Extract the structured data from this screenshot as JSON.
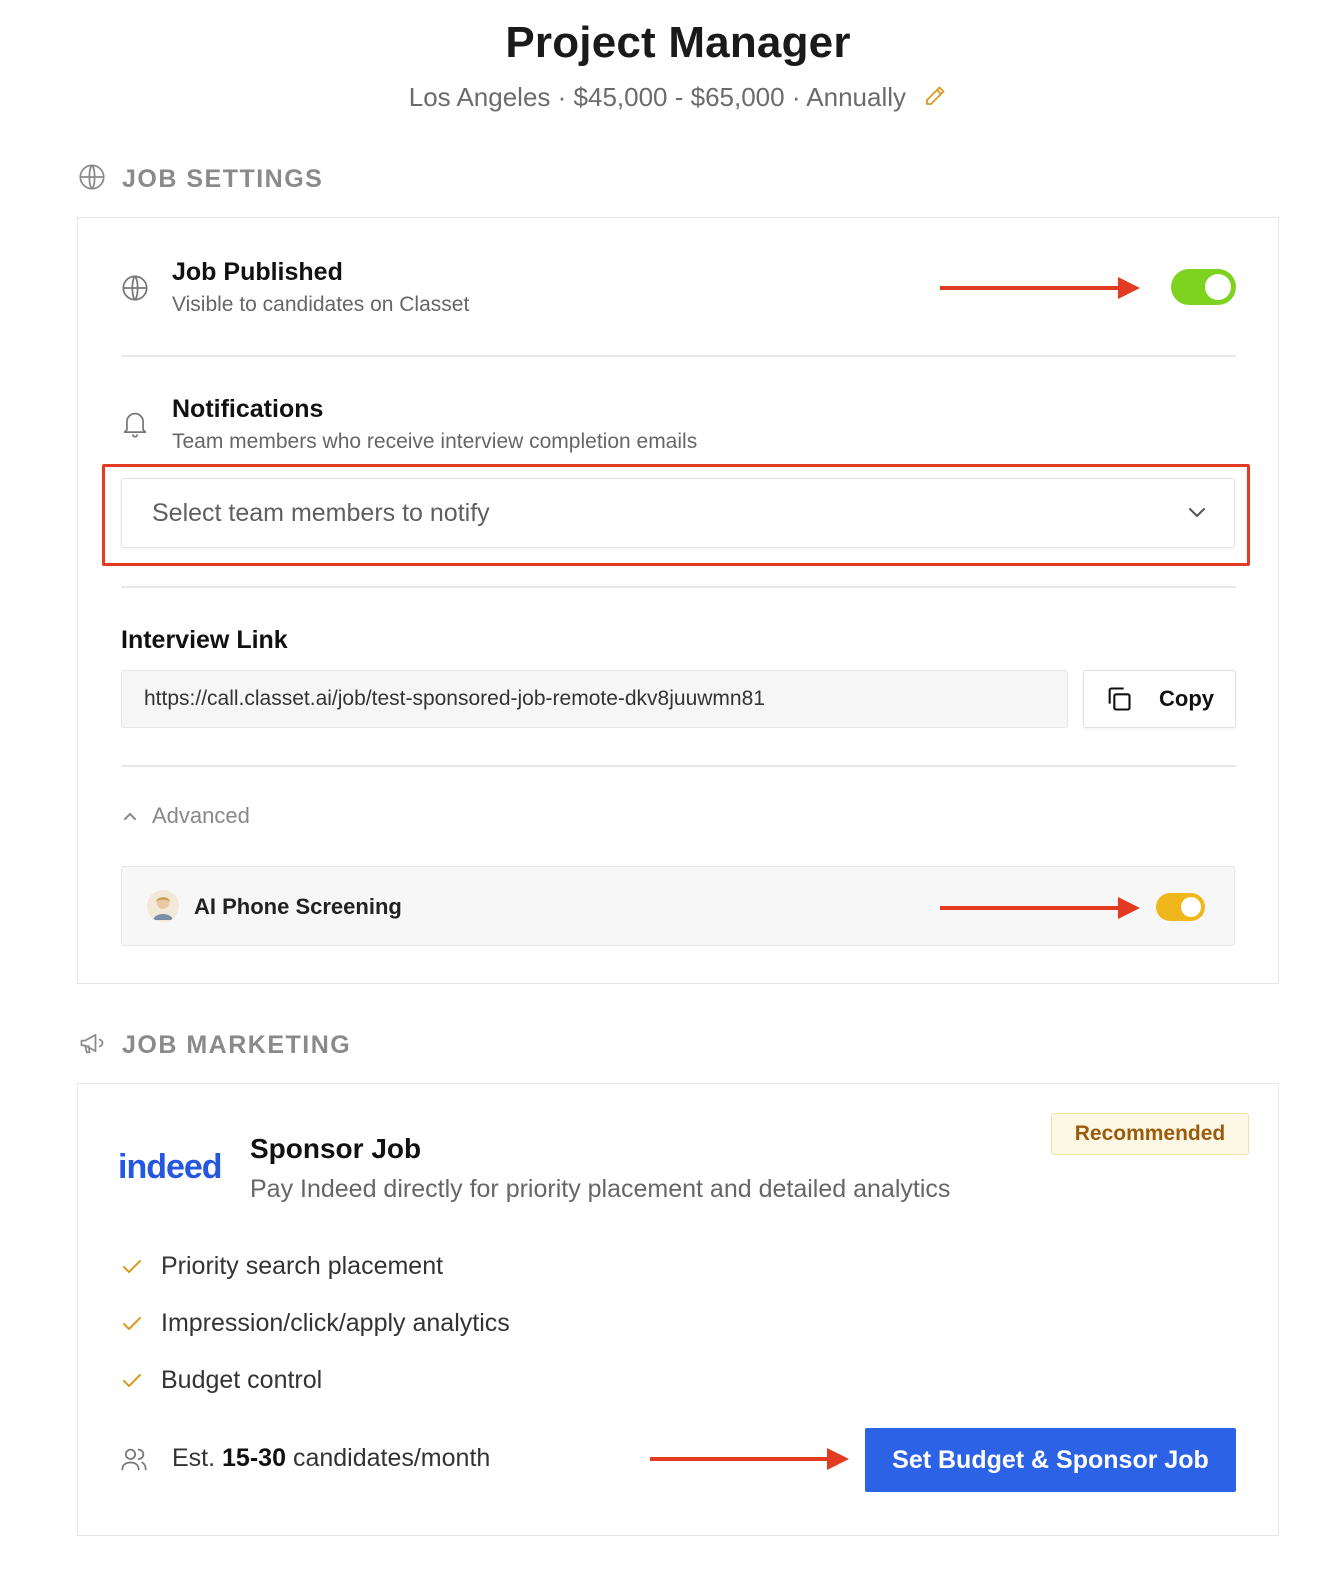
{
  "header": {
    "title": "Project Manager",
    "location": "Los Angeles",
    "salary": "$45,000 - $65,000",
    "period": "Annually",
    "separator": " · "
  },
  "job_settings": {
    "section_label": "JOB SETTINGS",
    "published": {
      "title": "Job Published",
      "subtitle": "Visible to candidates on Classet",
      "enabled": true,
      "toggle_color": "#7ed321"
    },
    "notifications": {
      "title": "Notifications",
      "subtitle": "Team members who receive interview completion emails",
      "select_placeholder": "Select team members to notify"
    },
    "interview_link": {
      "title": "Interview Link",
      "url": "https://call.classet.ai/job/test-sponsored-job-remote-dkv8juuwmn81",
      "copy_label": "Copy"
    },
    "advanced": {
      "label": "Advanced",
      "expanded": true,
      "ai_phone_screening": {
        "label": "AI Phone Screening",
        "enabled": true,
        "toggle_color": "#f0b71c"
      }
    }
  },
  "job_marketing": {
    "section_label": "JOB MARKETING",
    "sponsor": {
      "logo_text": "indeed",
      "title": "Sponsor Job",
      "subtitle": "Pay Indeed directly for priority placement and detailed analytics",
      "badge": "Recommended",
      "features": [
        "Priority search placement",
        "Impression/click/apply analytics",
        "Budget control"
      ],
      "estimate_prefix": "Est.",
      "estimate_range": "15-30",
      "estimate_suffix": "candidates/month",
      "cta_label": "Set Budget & Sponsor Job"
    }
  },
  "colors": {
    "annotation_red": "#e23b22",
    "primary_blue": "#2c63e6",
    "check_orange": "#d99a1e"
  }
}
